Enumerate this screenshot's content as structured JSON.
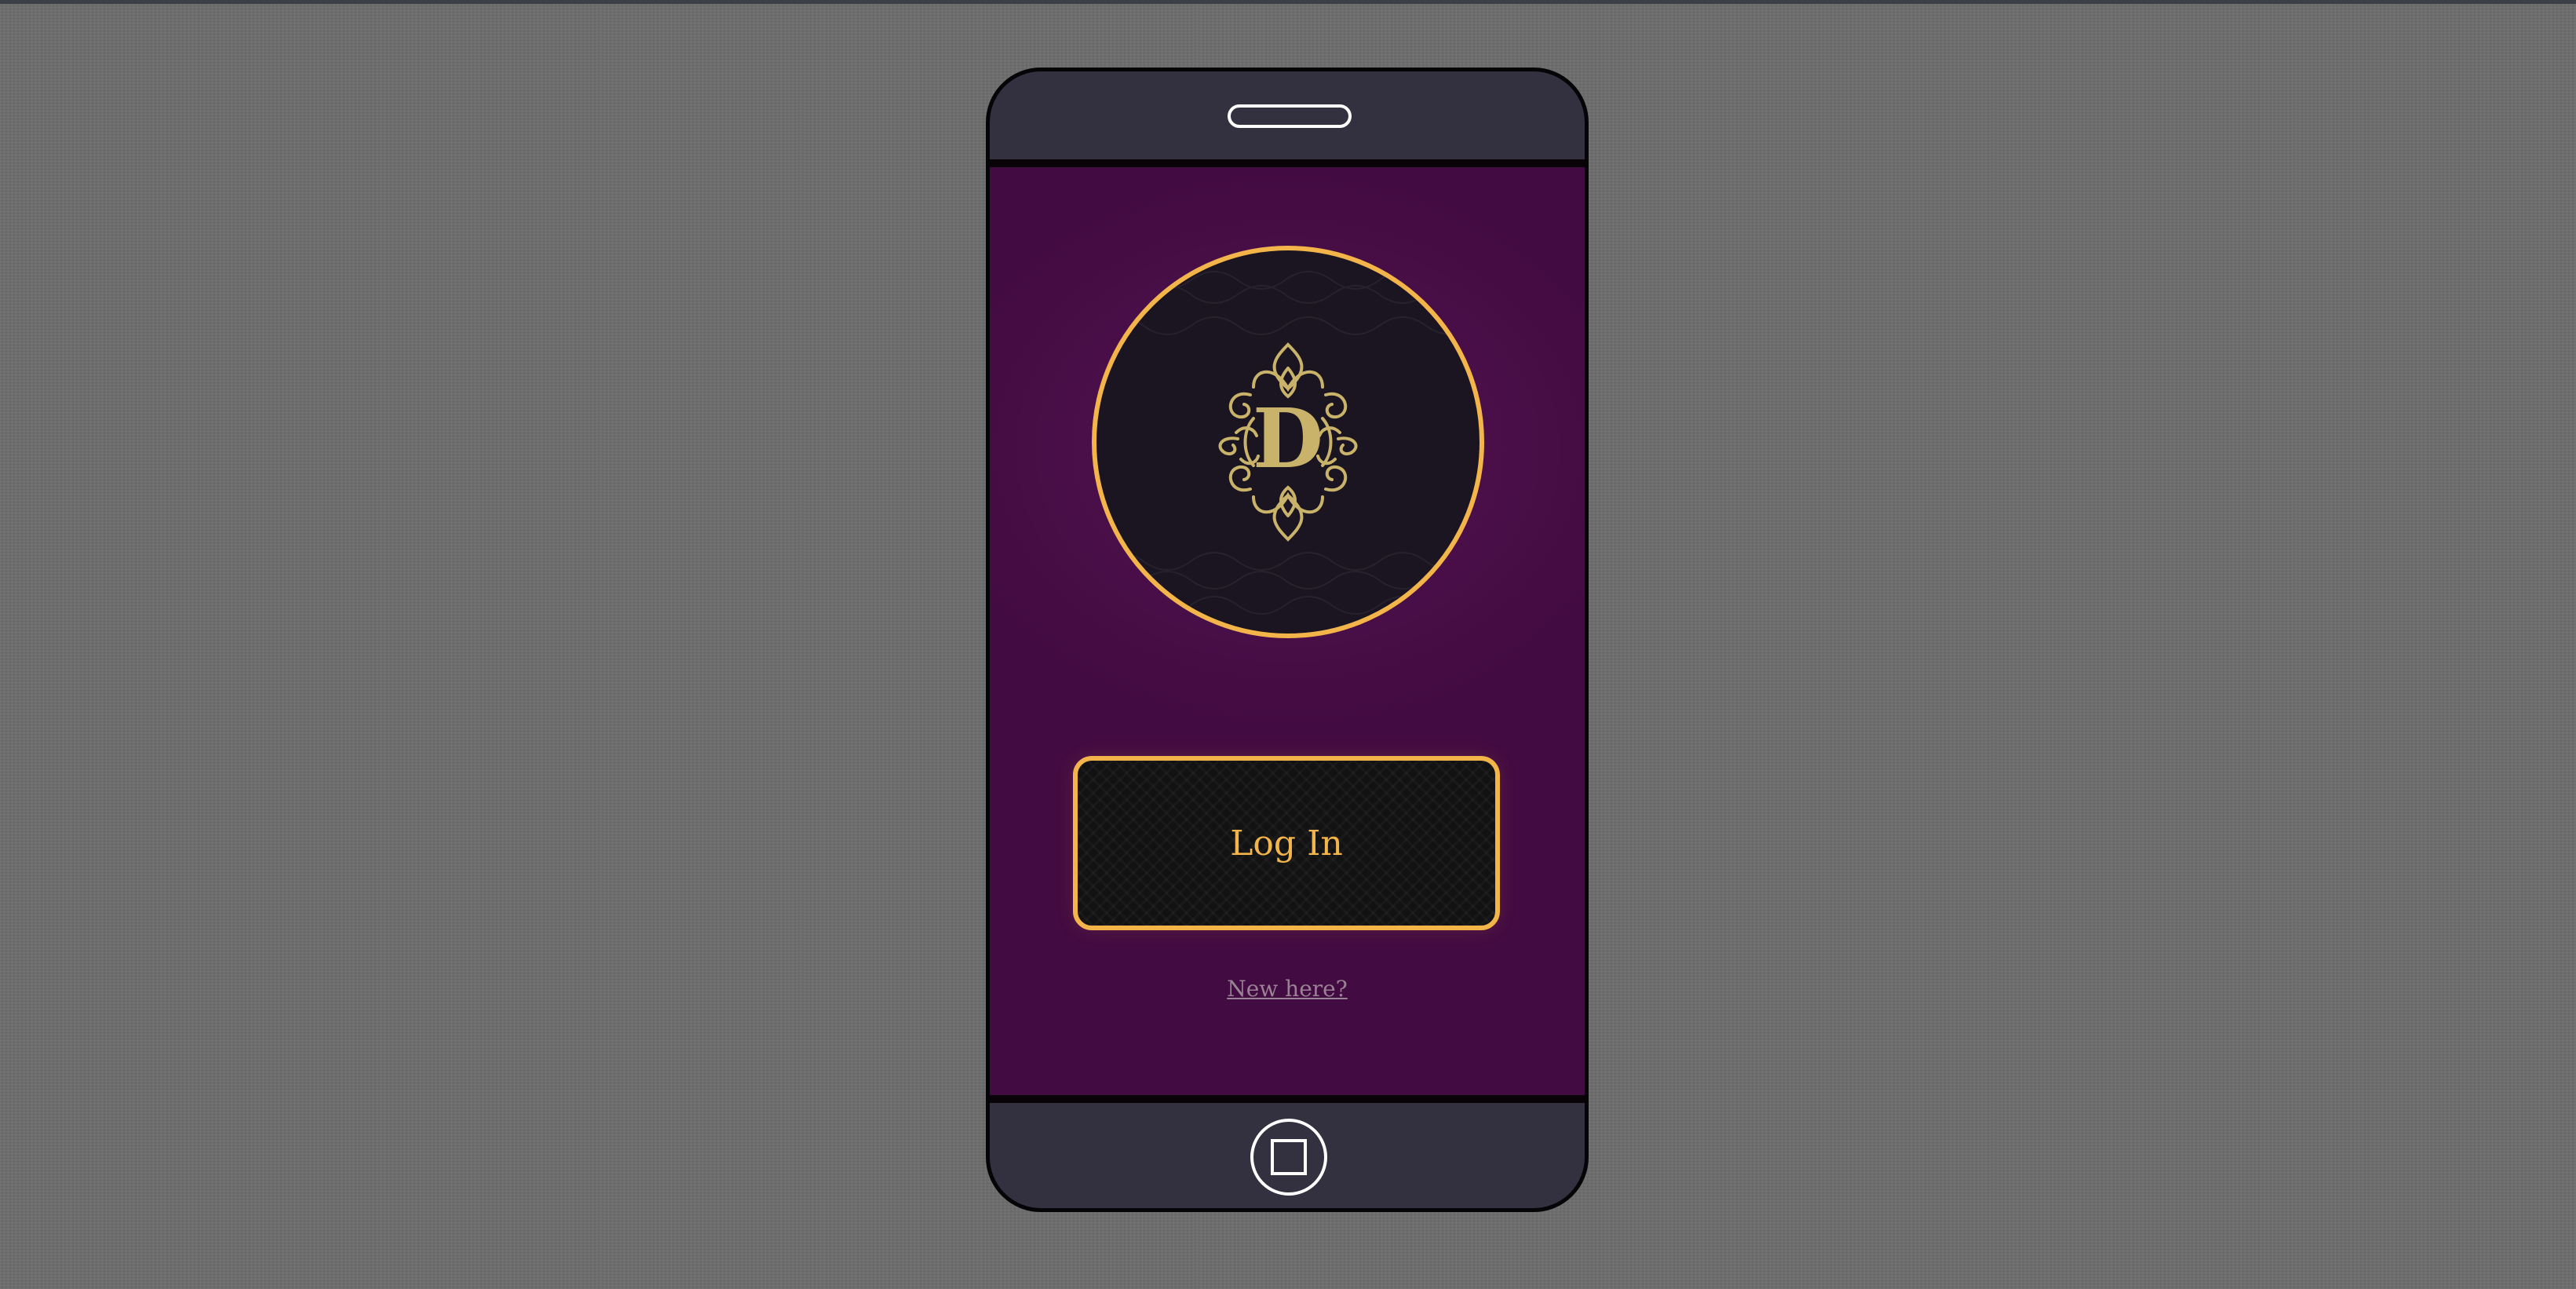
{
  "app": {
    "logo_letter": "D",
    "icons": {
      "logo": "ornate-monogram-logo",
      "speaker": "phone-speaker",
      "home": "home-button"
    }
  },
  "login": {
    "button_label": "Log In"
  },
  "signup": {
    "link_label": "New here?"
  },
  "colors": {
    "accent_gold": "#f3b54a",
    "screen_purple": "#4a0f49",
    "phone_body": "#33313f",
    "logo_ornament": "#c9b36a"
  }
}
